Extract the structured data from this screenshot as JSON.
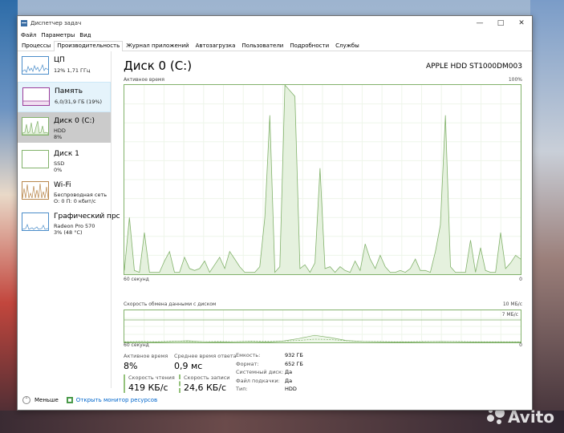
{
  "window": {
    "title": "Диспетчер задач"
  },
  "menu": [
    "Файл",
    "Параметры",
    "Вид"
  ],
  "tabs": [
    "Процессы",
    "Производительность",
    "Журнал приложений",
    "Автозагрузка",
    "Пользователи",
    "Подробности",
    "Службы"
  ],
  "sidebar": {
    "items": [
      {
        "title": "ЦП",
        "lines": [
          "12% 1,71 ГГц"
        ]
      },
      {
        "title": "Память",
        "lines": [
          "6,0/31,9 ГБ (19%)"
        ]
      },
      {
        "title": "Диск 0 (C:)",
        "lines": [
          "HDD",
          "8%"
        ]
      },
      {
        "title": "Диск 1",
        "lines": [
          "SSD",
          "0%"
        ]
      },
      {
        "title": "Wi-Fi",
        "lines": [
          "Беспроводная сеть",
          "О: 0 П: 0 кбит/с"
        ]
      },
      {
        "title": "Графический прс",
        "lines": [
          "Radeon Pro 570",
          "3% (48 °C)"
        ]
      }
    ]
  },
  "main": {
    "title": "Диск 0 (C:)",
    "model": "APPLE HDD ST1000DM003",
    "chart1": {
      "label": "Активное время",
      "max_label": "100%",
      "x_label": "60 секунд",
      "zero_label": "0",
      "values": [
        2,
        30,
        2,
        1,
        22,
        1,
        1,
        1,
        7,
        12,
        1,
        1,
        9,
        3,
        2,
        3,
        7,
        1,
        5,
        9,
        3,
        12,
        8,
        4,
        1,
        1,
        1,
        4,
        30,
        84,
        1,
        4,
        100,
        97,
        94,
        3,
        5,
        1,
        6,
        56,
        3,
        4,
        1,
        4,
        2,
        1,
        7,
        2,
        16,
        8,
        3,
        10,
        4,
        1,
        1,
        2,
        1,
        3,
        8,
        2,
        2,
        1,
        12,
        26,
        84,
        4,
        1,
        1,
        1,
        18,
        1,
        14,
        2,
        1,
        1,
        22,
        3,
        6,
        10,
        8
      ],
      "color": "#82b26b"
    },
    "chart2": {
      "label": "Скорость обмена данными с диском",
      "max_label": "10 МБ/с",
      "inner_label": "7 МБ/с",
      "x_label": "60 секунд",
      "zero_label": "0",
      "read": [
        0.1,
        0.2,
        0.1,
        0.3,
        0.5,
        0.2,
        0.1,
        0.2,
        0.3,
        0.1,
        0.4,
        1.2,
        2.2,
        1.5,
        0.6,
        0.3,
        0.2,
        0.1,
        0.1,
        0.2,
        0.3,
        0.2,
        0.1,
        0.1,
        0.1,
        0.1
      ],
      "write": [
        0.2,
        0.3,
        0.2,
        0.4,
        0.3,
        0.2,
        0.3,
        0.2,
        0.4,
        0.3,
        0.4,
        0.6,
        1.0,
        0.9,
        0.5,
        0.3,
        0.3,
        0.2,
        0.2,
        0.3,
        0.2,
        0.3,
        0.2,
        0.2,
        0.2,
        0.2
      ]
    },
    "stats": {
      "active_label": "Активное время",
      "active_value": "8%",
      "avg_label": "Среднее время ответа",
      "avg_value": "0,9 мс",
      "read_label": "Скорость чтения",
      "read_value": "419 КБ/с",
      "write_label": "Скорость записи",
      "write_value": "24,6 КБ/с"
    },
    "props": [
      {
        "k": "Емкость:",
        "v": "932 ГБ"
      },
      {
        "k": "Формат:",
        "v": "652 ГБ"
      },
      {
        "k": "Системный диск:",
        "v": "Да"
      },
      {
        "k": "Файл подкачки:",
        "v": "Да"
      },
      {
        "k": "Тип:",
        "v": "HDD"
      }
    ]
  },
  "footer": {
    "fewer": "Меньше",
    "resmon": "Открыть монитор ресурсов"
  },
  "watermark": "Avito"
}
